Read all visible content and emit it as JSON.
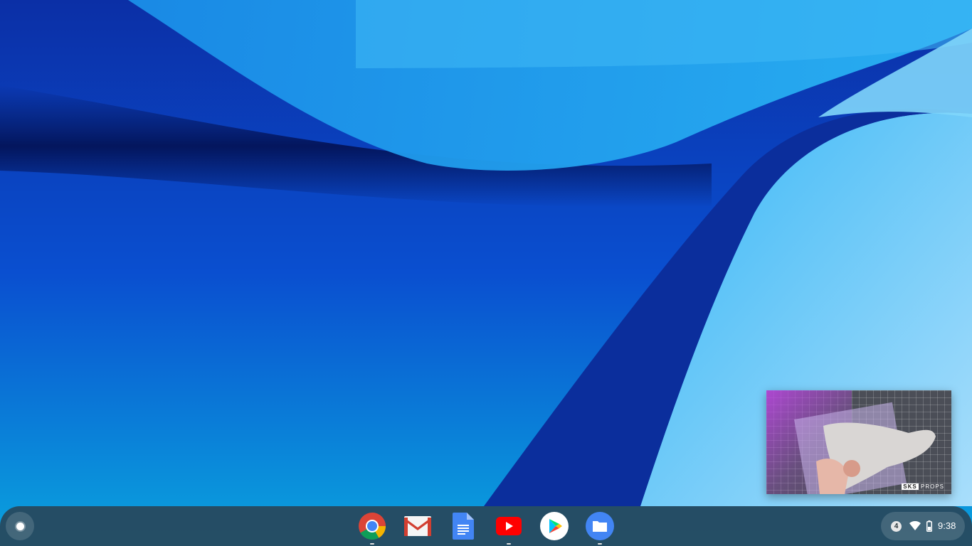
{
  "shelf": {
    "launcher": {
      "icon": "launcher-icon"
    },
    "apps": [
      {
        "name": "Chrome",
        "icon": "chrome-icon",
        "running": true
      },
      {
        "name": "Gmail",
        "icon": "gmail-icon",
        "running": false
      },
      {
        "name": "Docs",
        "icon": "docs-icon",
        "running": false
      },
      {
        "name": "YouTube",
        "icon": "youtube-icon",
        "running": true
      },
      {
        "name": "Play Store",
        "icon": "play-store-icon",
        "running": false
      },
      {
        "name": "Files",
        "icon": "files-icon",
        "running": true
      }
    ],
    "status": {
      "notification_count": "4",
      "wifi": "wifi-icon",
      "battery": "battery-icon",
      "time": "9:38"
    }
  },
  "pip": {
    "logo_sks": "SKS",
    "logo_props": "PROPS"
  },
  "colors": {
    "shelf": "#284658",
    "wallpaper_deep": "#0a2a9a",
    "wallpaper_light": "#8fd5fa"
  }
}
